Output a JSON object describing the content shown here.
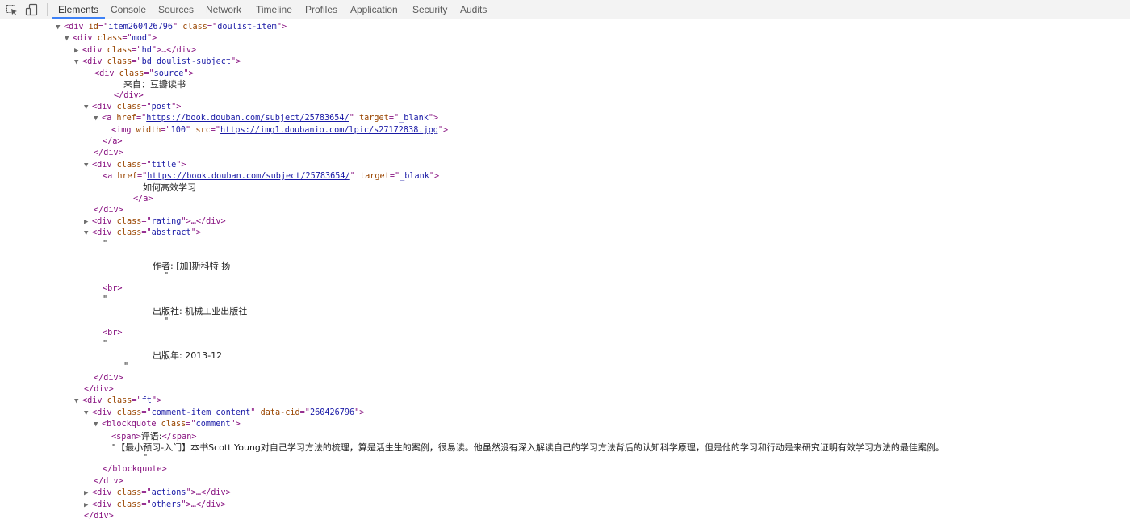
{
  "tabs": [
    "Elements",
    "Console",
    "Sources",
    "Network",
    "Timeline",
    "Profiles",
    "Application",
    "Security",
    "Audits"
  ],
  "tree": {
    "item_id": "item260426796",
    "doulist_item_class": "doulist-item",
    "mod_class": "mod",
    "hd_class": "hd",
    "bd_class": "bd doulist-subject",
    "source_class": "source",
    "source_text": "来自：豆瓣读书",
    "post_class": "post",
    "post_href": "https://book.douban.com/subject/25783654/",
    "target": "_blank",
    "img_width": "100",
    "img_src": "https://img1.doubanio.com/lpic/s27172838.jpg",
    "title_class": "title",
    "title_href": "https://book.douban.com/subject/25783654/",
    "title_text": "如何高效学习",
    "rating_class": "rating",
    "abstract_class": "abstract",
    "author": "作者: [加]斯科特·扬",
    "publisher": "出版社: 机械工业出版社",
    "year": "出版年: 2013-12",
    "ft_class": "ft",
    "comment_item_class": "comment-item content",
    "data_cid": "260426796",
    "blockquote_class": "comment",
    "comment_label": "评语:",
    "comment_text": "【最小预习-入门】本书Scott Young对自己学习方法的梳理，算是活生生的案例，很易读。他虽然没有深入解读自己的学习方法背后的认知科学原理，但是他的学习和行动是来研究证明有效学习方法的最佳案例。",
    "actions_class": "actions",
    "others_class": "others"
  }
}
